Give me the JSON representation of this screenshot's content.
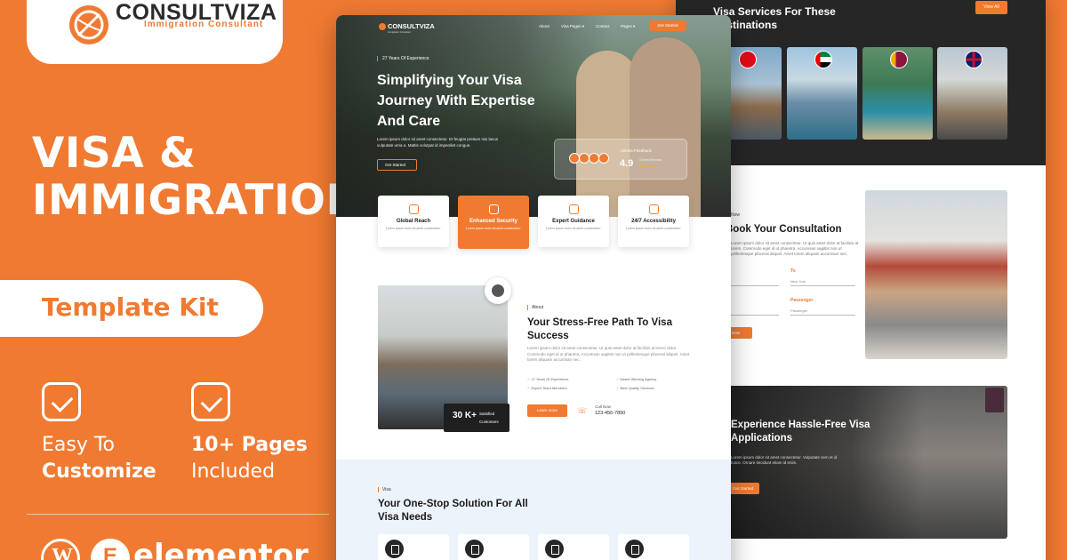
{
  "brand": {
    "name": "CONSULTVIZA",
    "tagline": "Immigration Consultant",
    "accent": "#f07a32"
  },
  "hero": {
    "title_line1": "VISA &",
    "title_line2": "IMMIGRATION",
    "kit_label": "Template Kit"
  },
  "features": [
    {
      "line1": "Easy To",
      "line2": "Customize",
      "icon": "checkbox-icon"
    },
    {
      "line1": "10+ Pages",
      "line2": "Included",
      "icon": "checkbox-icon"
    }
  ],
  "builder": {
    "wordpress_glyph": "W",
    "elementor_glyph": "E",
    "elementor_word": "elementor"
  },
  "front_mock": {
    "nav": {
      "logo": "CONSULTVIZA",
      "logo_sub": "Immigration Consultant",
      "items": [
        "About",
        "Visa Pages ▾",
        "Contact",
        "Pages ▾"
      ],
      "cta": "Get Started"
    },
    "hero": {
      "tag": "27 Years Of Experience",
      "heading": "Simplifying Your Visa Journey With Expertise And Care",
      "body": "Lorem ipsum dolor sit amet consectetur. Et feugiat pretium nisi lacus vulputate urna a. Mattis volutpat id imperdiet congue.",
      "button": "Get Started",
      "feedback_label": "Clients Feedback",
      "feedback_score": "4.9",
      "feedback_sub": "Overall Reviews",
      "feedback_stars": "★★★★★"
    },
    "cards": [
      {
        "title": "Global Reach",
        "desc": "Lorem ipsum dolor sit amet consectetur."
      },
      {
        "title": "Enhanced Security",
        "desc": "Lorem ipsum dolor sit amet consectetur."
      },
      {
        "title": "Expert Guidance",
        "desc": "Lorem ipsum dolor sit amet consectetur."
      },
      {
        "title": "24/7 Accessibility",
        "desc": "Lorem ipsum dolor sit amet consectetur."
      }
    ],
    "about": {
      "eyebrow": "About",
      "title": "Your Stress-Free Path To Visa Success",
      "desc": "Lorem ipsum dolor sit amet consectetur. Ut quis amet dolor at facilisis at lorem dolor. Commodo eget id ut pharetra. Accumsan sagittis non ut pellentesque placerat aliquet. Amet lorem aliquam accumsan nec.",
      "checks": [
        "27 Years Of Experience",
        "Award Winning Agency",
        "Expert Team Members",
        "Best Quality Services"
      ],
      "stat_num": "30 K+",
      "stat_label": "Satisfied Customers",
      "learn_btn": "Learn more",
      "call_label": "Call Now",
      "call_number": "123-456-7890"
    },
    "visa": {
      "eyebrow": "Visa",
      "title": "Your One-Stop Solution For All Visa Needs"
    }
  },
  "back_mock": {
    "dest_title": "Visa Services For These Destinations",
    "view_all": "View All",
    "book_eyebrow": "Now",
    "book_title": "Book Your Consultation",
    "book_desc": "Lorem ipsum dolor sit amet consectetur. Ut quis amet dolor at facilisis at lorem. Commodo eget id ut pharetra. Accumsan sagittis non ut pellentesque placerat aliquet. Amet lorem aliquam accumsan nec.",
    "field_to": "To",
    "field_to_ph": "New York",
    "field_passenger": "Passenger",
    "field_passenger_ph": "Passenger",
    "book_btn": "Now",
    "apply_title": "Experience Hassle-Free Visa Applications",
    "apply_desc": "Lorem ipsum dolor sit amet consectetur. Vulputate sem et id fusce. Ornare tincidunt etiam id enim.",
    "apply_btn": "Get Started"
  }
}
